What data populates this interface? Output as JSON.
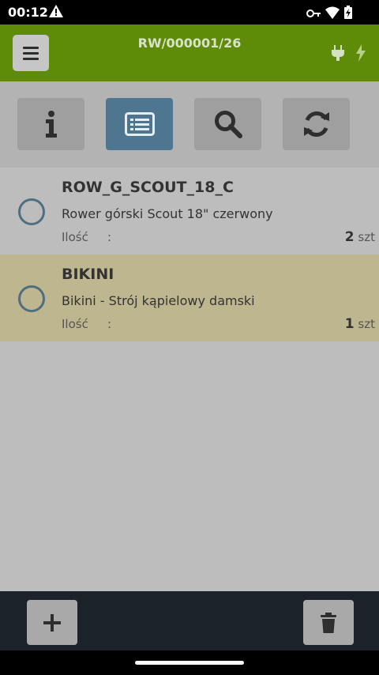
{
  "status_bar": {
    "time": "00:12"
  },
  "app_bar": {
    "title": "RW/000001/26",
    "accent_color": "#5e8c08"
  },
  "toolbar": {
    "buttons": [
      {
        "icon": "info-icon",
        "active": false
      },
      {
        "icon": "list-icon",
        "active": true
      },
      {
        "icon": "search-icon",
        "active": false
      },
      {
        "icon": "refresh-icon",
        "active": false
      }
    ]
  },
  "items": [
    {
      "code": "ROW_G_SCOUT_18_C",
      "description": "Rower górski Scout 18\" czerwony",
      "qty_label": "Ilość",
      "qty_sep": ":",
      "qty": "2",
      "unit": "szt",
      "highlighted": false
    },
    {
      "code": "BIKINI",
      "description": "Bikini - Strój kąpielowy damski",
      "qty_label": "Ilość",
      "qty_sep": ":",
      "qty": "1",
      "unit": "szt",
      "highlighted": true
    }
  ],
  "bottom_bar": {
    "left_icon": "plus-icon",
    "right_icon": "trash-icon"
  }
}
